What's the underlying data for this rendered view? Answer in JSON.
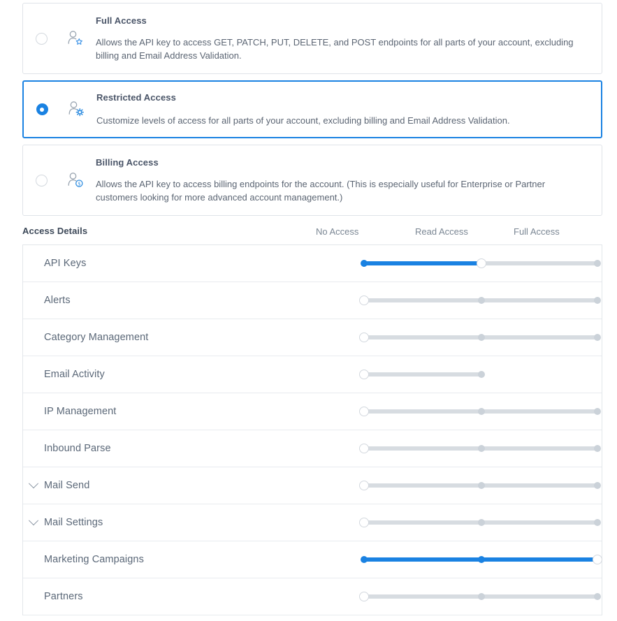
{
  "access_types": {
    "options": [
      {
        "id": "full-access",
        "title": "Full Access",
        "description": "Allows the API key to access GET, PATCH, PUT, DELETE, and POST endpoints for all parts of your account, excluding billing and Email Address Validation.",
        "icon": "user-star-icon",
        "selected": false
      },
      {
        "id": "restricted-access",
        "title": "Restricted Access",
        "description": "Customize levels of access for all parts of your account, excluding billing and Email Address Validation.",
        "icon": "user-gear-icon",
        "selected": true
      },
      {
        "id": "billing-access",
        "title": "Billing Access",
        "description": "Allows the API key to access billing endpoints for the account. (This is especially useful for Enterprise or Partner customers looking for more advanced account management.)",
        "icon": "user-dollar-icon",
        "selected": false
      }
    ]
  },
  "access_details": {
    "title": "Access Details",
    "columns": [
      "No Access",
      "Read Access",
      "Full Access"
    ],
    "rows": [
      {
        "label": "API Keys",
        "expandable": false,
        "level": 1,
        "stops": 3
      },
      {
        "label": "Alerts",
        "expandable": false,
        "level": 0,
        "stops": 3
      },
      {
        "label": "Category Management",
        "expandable": false,
        "level": 0,
        "stops": 3
      },
      {
        "label": "Email Activity",
        "expandable": false,
        "level": 0,
        "stops": 2
      },
      {
        "label": "IP Management",
        "expandable": false,
        "level": 0,
        "stops": 3
      },
      {
        "label": "Inbound Parse",
        "expandable": false,
        "level": 0,
        "stops": 3
      },
      {
        "label": "Mail Send",
        "expandable": true,
        "level": 0,
        "stops": 3
      },
      {
        "label": "Mail Settings",
        "expandable": true,
        "level": 0,
        "stops": 3
      },
      {
        "label": "Marketing Campaigns",
        "expandable": false,
        "level": 2,
        "stops": 2
      },
      {
        "label": "Partners",
        "expandable": false,
        "level": 0,
        "stops": 3
      }
    ]
  },
  "colors": {
    "accent": "#1a82e2",
    "track": "#d7dce1",
    "stop": "#cbd2d9",
    "text": "#5b6878",
    "border": "#e2e6ea"
  }
}
